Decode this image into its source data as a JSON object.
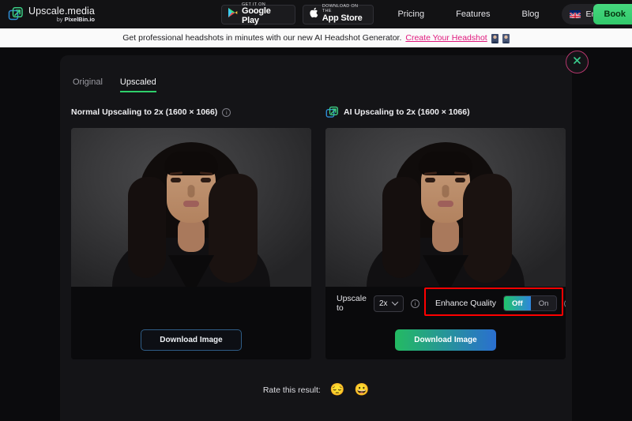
{
  "header": {
    "logo": {
      "title": "Upscale.media",
      "sub_prefix": "by ",
      "sub_brand": "PixelBin.io",
      "icon": "upscale-arrow-icon"
    },
    "badges": [
      {
        "id": "google-play",
        "top": "GET IT ON",
        "main": "Google Play",
        "icon": "google-play-icon"
      },
      {
        "id": "app-store",
        "top": "Download on the",
        "main": "App Store",
        "icon": "apple-icon"
      }
    ],
    "nav": [
      {
        "label": "Pricing"
      },
      {
        "label": "Features"
      },
      {
        "label": "Blog"
      }
    ],
    "language": {
      "label": "English",
      "flag": "uk-flag-icon",
      "chevron": "chevron-down-icon"
    },
    "cta": {
      "label": "Book"
    }
  },
  "banner": {
    "text": "Get professional headshots in minutes with our new AI Headshot Generator.",
    "link": "Create Your Headshot",
    "avatars": [
      "avatar-icon-1",
      "avatar-icon-2"
    ]
  },
  "modal": {
    "close_icon": "close-icon",
    "tabs": [
      {
        "label": "Original",
        "active": false
      },
      {
        "label": "Upscaled",
        "active": true
      }
    ],
    "panels": [
      {
        "id": "normal",
        "title": "Normal Upscaling to 2x (1600 × 1066)",
        "info_icon": "info-icon",
        "download_label": "Download Image"
      },
      {
        "id": "ai",
        "icon": "ai-upscale-icon",
        "title": "AI Upscaling to 2x (1600 × 1066)",
        "upscale_to_label": "Upscale to",
        "upscale_value": "2x",
        "upscale_info_icon": "info-icon",
        "enhance_label": "Enhance Quality",
        "enhance_options": [
          {
            "label": "Off",
            "selected": true
          },
          {
            "label": "On",
            "selected": false
          }
        ],
        "enhance_info_icon": "info-icon",
        "download_label": "Download Image"
      }
    ],
    "rate": {
      "label": "Rate this result:",
      "emojis": [
        "😔",
        "😀"
      ]
    }
  },
  "colors": {
    "accent_green": "#2fcf6a",
    "accent_blue": "#2a6fd0",
    "banner_link": "#e0197d",
    "highlight_box": "#fe0000",
    "page_bg": "#0b0b0d",
    "card_bg": "#141417"
  }
}
